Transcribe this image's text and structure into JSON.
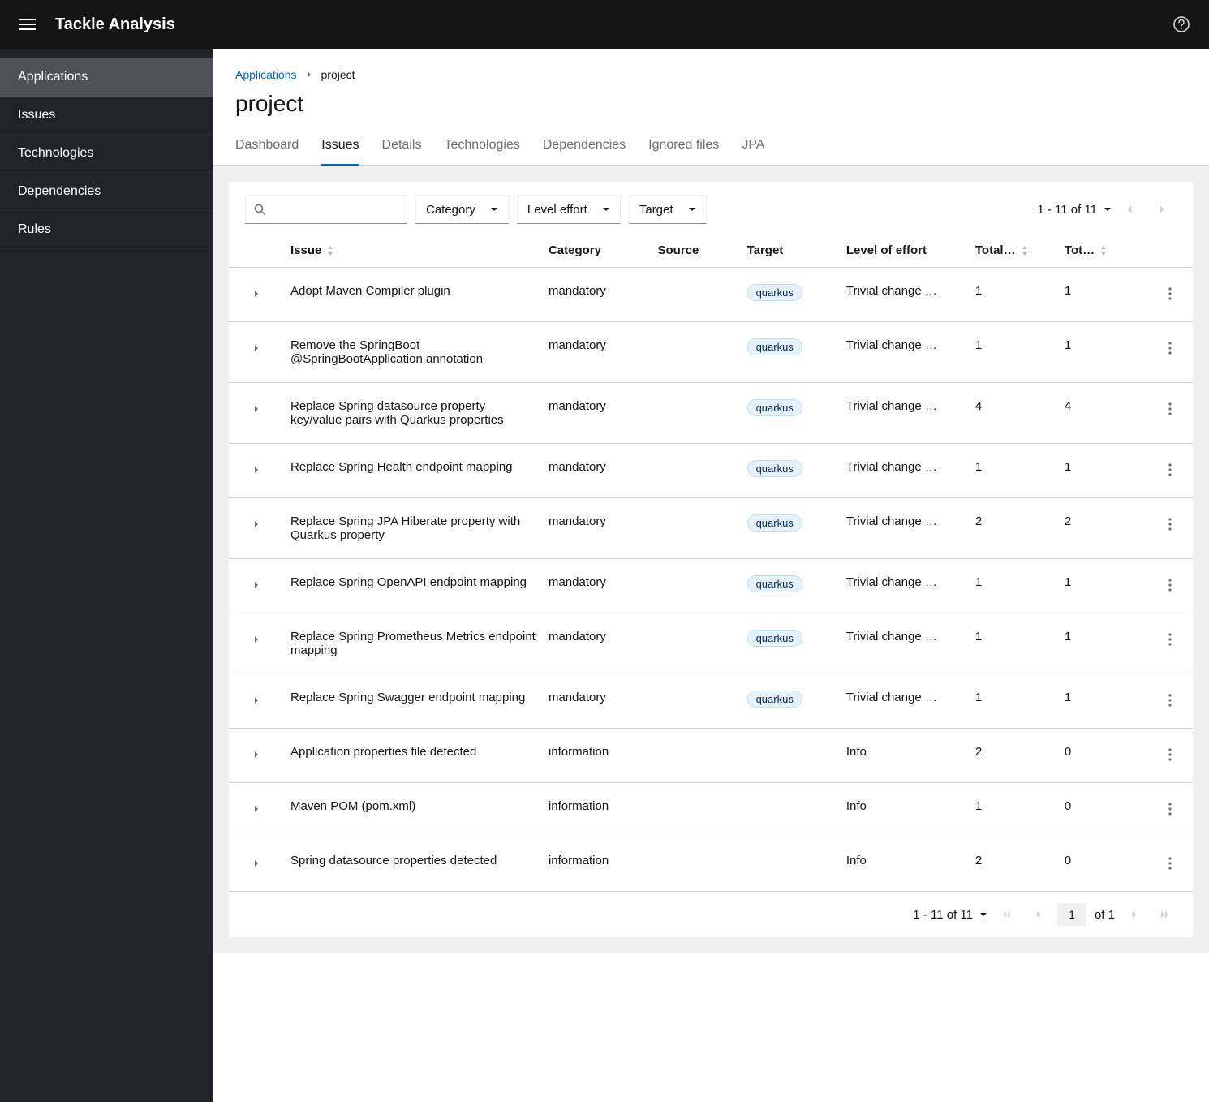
{
  "brand": "Tackle Analysis",
  "sidebar": {
    "items": [
      "Applications",
      "Issues",
      "Technologies",
      "Dependencies",
      "Rules"
    ],
    "activeIndex": 0
  },
  "breadcrumb": {
    "root": "Applications",
    "current": "project"
  },
  "title": "project",
  "tabs": {
    "items": [
      "Dashboard",
      "Issues",
      "Details",
      "Technologies",
      "Dependencies",
      "Ignored files",
      "JPA"
    ],
    "activeIndex": 1
  },
  "filters": {
    "category": "Category",
    "level_effort": "Level effort",
    "target": "Target"
  },
  "pagination": {
    "top_range": "1 - 11 of 11",
    "bottom_range": "1 - 11 of 11",
    "page_input": "1",
    "of_text": "of 1"
  },
  "columns": {
    "issue": "Issue",
    "category": "Category",
    "source": "Source",
    "target": "Target",
    "level": "Level of effort",
    "total1": "Total…",
    "total2": "Tot…"
  },
  "rows": [
    {
      "issue": "Adopt Maven Compiler plugin",
      "category": "mandatory",
      "source": "",
      "target": "quarkus",
      "level": "Trivial change …",
      "total1": "1",
      "total2": "1"
    },
    {
      "issue": "Remove the SpringBoot @SpringBootApplication annotation",
      "category": "mandatory",
      "source": "",
      "target": "quarkus",
      "level": "Trivial change …",
      "total1": "1",
      "total2": "1"
    },
    {
      "issue": "Replace Spring datasource property key/value pairs with Quarkus properties",
      "category": "mandatory",
      "source": "",
      "target": "quarkus",
      "level": "Trivial change …",
      "total1": "4",
      "total2": "4"
    },
    {
      "issue": "Replace Spring Health endpoint mapping",
      "category": "mandatory",
      "source": "",
      "target": "quarkus",
      "level": "Trivial change …",
      "total1": "1",
      "total2": "1"
    },
    {
      "issue": "Replace Spring JPA Hiberate property with Quarkus property",
      "category": "mandatory",
      "source": "",
      "target": "quarkus",
      "level": "Trivial change …",
      "total1": "2",
      "total2": "2"
    },
    {
      "issue": "Replace Spring OpenAPI endpoint mapping",
      "category": "mandatory",
      "source": "",
      "target": "quarkus",
      "level": "Trivial change …",
      "total1": "1",
      "total2": "1"
    },
    {
      "issue": "Replace Spring Prometheus Metrics endpoint mapping",
      "category": "mandatory",
      "source": "",
      "target": "quarkus",
      "level": "Trivial change …",
      "total1": "1",
      "total2": "1"
    },
    {
      "issue": "Replace Spring Swagger endpoint mapping",
      "category": "mandatory",
      "source": "",
      "target": "quarkus",
      "level": "Trivial change …",
      "total1": "1",
      "total2": "1"
    },
    {
      "issue": "Application properties file detected",
      "category": "information",
      "source": "",
      "target": "",
      "level": "Info",
      "total1": "2",
      "total2": "0"
    },
    {
      "issue": "Maven POM (pom.xml)",
      "category": "information",
      "source": "",
      "target": "",
      "level": "Info",
      "total1": "1",
      "total2": "0"
    },
    {
      "issue": "Spring datasource properties detected",
      "category": "information",
      "source": "",
      "target": "",
      "level": "Info",
      "total1": "2",
      "total2": "0"
    }
  ]
}
